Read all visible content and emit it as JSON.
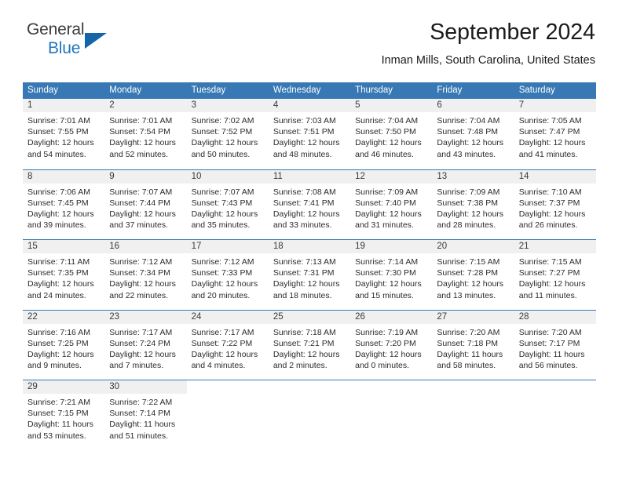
{
  "brand": {
    "name_top": "General",
    "name_bottom": "Blue",
    "triangle_icon": "blue-triangle-icon",
    "color_top": "#3c3c3c",
    "color_bottom": "#2176bd"
  },
  "header": {
    "title": "September 2024",
    "subtitle": "Inman Mills, South Carolina, United States"
  },
  "colors": {
    "header_row_background": "#3878b4",
    "header_row_text": "#ffffff",
    "day_number_band": "#f0f0f0",
    "week_separator": "#3878b4",
    "body_text": "#2b2b2b"
  },
  "weekday_headers": [
    "Sunday",
    "Monday",
    "Tuesday",
    "Wednesday",
    "Thursday",
    "Friday",
    "Saturday"
  ],
  "labels": {
    "sunrise_prefix": "Sunrise:",
    "sunset_prefix": "Sunset:",
    "daylight_prefix": "Daylight:"
  },
  "weeks": [
    {
      "days": [
        {
          "num": "1",
          "l1": "Sunrise: 7:01 AM",
          "l2": "Sunset: 7:55 PM",
          "l3": "Daylight: 12 hours",
          "l4": "and 54 minutes."
        },
        {
          "num": "2",
          "l1": "Sunrise: 7:01 AM",
          "l2": "Sunset: 7:54 PM",
          "l3": "Daylight: 12 hours",
          "l4": "and 52 minutes."
        },
        {
          "num": "3",
          "l1": "Sunrise: 7:02 AM",
          "l2": "Sunset: 7:52 PM",
          "l3": "Daylight: 12 hours",
          "l4": "and 50 minutes."
        },
        {
          "num": "4",
          "l1": "Sunrise: 7:03 AM",
          "l2": "Sunset: 7:51 PM",
          "l3": "Daylight: 12 hours",
          "l4": "and 48 minutes."
        },
        {
          "num": "5",
          "l1": "Sunrise: 7:04 AM",
          "l2": "Sunset: 7:50 PM",
          "l3": "Daylight: 12 hours",
          "l4": "and 46 minutes."
        },
        {
          "num": "6",
          "l1": "Sunrise: 7:04 AM",
          "l2": "Sunset: 7:48 PM",
          "l3": "Daylight: 12 hours",
          "l4": "and 43 minutes."
        },
        {
          "num": "7",
          "l1": "Sunrise: 7:05 AM",
          "l2": "Sunset: 7:47 PM",
          "l3": "Daylight: 12 hours",
          "l4": "and 41 minutes."
        }
      ]
    },
    {
      "days": [
        {
          "num": "8",
          "l1": "Sunrise: 7:06 AM",
          "l2": "Sunset: 7:45 PM",
          "l3": "Daylight: 12 hours",
          "l4": "and 39 minutes."
        },
        {
          "num": "9",
          "l1": "Sunrise: 7:07 AM",
          "l2": "Sunset: 7:44 PM",
          "l3": "Daylight: 12 hours",
          "l4": "and 37 minutes."
        },
        {
          "num": "10",
          "l1": "Sunrise: 7:07 AM",
          "l2": "Sunset: 7:43 PM",
          "l3": "Daylight: 12 hours",
          "l4": "and 35 minutes."
        },
        {
          "num": "11",
          "l1": "Sunrise: 7:08 AM",
          "l2": "Sunset: 7:41 PM",
          "l3": "Daylight: 12 hours",
          "l4": "and 33 minutes."
        },
        {
          "num": "12",
          "l1": "Sunrise: 7:09 AM",
          "l2": "Sunset: 7:40 PM",
          "l3": "Daylight: 12 hours",
          "l4": "and 31 minutes."
        },
        {
          "num": "13",
          "l1": "Sunrise: 7:09 AM",
          "l2": "Sunset: 7:38 PM",
          "l3": "Daylight: 12 hours",
          "l4": "and 28 minutes."
        },
        {
          "num": "14",
          "l1": "Sunrise: 7:10 AM",
          "l2": "Sunset: 7:37 PM",
          "l3": "Daylight: 12 hours",
          "l4": "and 26 minutes."
        }
      ]
    },
    {
      "days": [
        {
          "num": "15",
          "l1": "Sunrise: 7:11 AM",
          "l2": "Sunset: 7:35 PM",
          "l3": "Daylight: 12 hours",
          "l4": "and 24 minutes."
        },
        {
          "num": "16",
          "l1": "Sunrise: 7:12 AM",
          "l2": "Sunset: 7:34 PM",
          "l3": "Daylight: 12 hours",
          "l4": "and 22 minutes."
        },
        {
          "num": "17",
          "l1": "Sunrise: 7:12 AM",
          "l2": "Sunset: 7:33 PM",
          "l3": "Daylight: 12 hours",
          "l4": "and 20 minutes."
        },
        {
          "num": "18",
          "l1": "Sunrise: 7:13 AM",
          "l2": "Sunset: 7:31 PM",
          "l3": "Daylight: 12 hours",
          "l4": "and 18 minutes."
        },
        {
          "num": "19",
          "l1": "Sunrise: 7:14 AM",
          "l2": "Sunset: 7:30 PM",
          "l3": "Daylight: 12 hours",
          "l4": "and 15 minutes."
        },
        {
          "num": "20",
          "l1": "Sunrise: 7:15 AM",
          "l2": "Sunset: 7:28 PM",
          "l3": "Daylight: 12 hours",
          "l4": "and 13 minutes."
        },
        {
          "num": "21",
          "l1": "Sunrise: 7:15 AM",
          "l2": "Sunset: 7:27 PM",
          "l3": "Daylight: 12 hours",
          "l4": "and 11 minutes."
        }
      ]
    },
    {
      "days": [
        {
          "num": "22",
          "l1": "Sunrise: 7:16 AM",
          "l2": "Sunset: 7:25 PM",
          "l3": "Daylight: 12 hours",
          "l4": "and 9 minutes."
        },
        {
          "num": "23",
          "l1": "Sunrise: 7:17 AM",
          "l2": "Sunset: 7:24 PM",
          "l3": "Daylight: 12 hours",
          "l4": "and 7 minutes."
        },
        {
          "num": "24",
          "l1": "Sunrise: 7:17 AM",
          "l2": "Sunset: 7:22 PM",
          "l3": "Daylight: 12 hours",
          "l4": "and 4 minutes."
        },
        {
          "num": "25",
          "l1": "Sunrise: 7:18 AM",
          "l2": "Sunset: 7:21 PM",
          "l3": "Daylight: 12 hours",
          "l4": "and 2 minutes."
        },
        {
          "num": "26",
          "l1": "Sunrise: 7:19 AM",
          "l2": "Sunset: 7:20 PM",
          "l3": "Daylight: 12 hours",
          "l4": "and 0 minutes."
        },
        {
          "num": "27",
          "l1": "Sunrise: 7:20 AM",
          "l2": "Sunset: 7:18 PM",
          "l3": "Daylight: 11 hours",
          "l4": "and 58 minutes."
        },
        {
          "num": "28",
          "l1": "Sunrise: 7:20 AM",
          "l2": "Sunset: 7:17 PM",
          "l3": "Daylight: 11 hours",
          "l4": "and 56 minutes."
        }
      ]
    },
    {
      "days": [
        {
          "num": "29",
          "l1": "Sunrise: 7:21 AM",
          "l2": "Sunset: 7:15 PM",
          "l3": "Daylight: 11 hours",
          "l4": "and 53 minutes."
        },
        {
          "num": "30",
          "l1": "Sunrise: 7:22 AM",
          "l2": "Sunset: 7:14 PM",
          "l3": "Daylight: 11 hours",
          "l4": "and 51 minutes."
        },
        {
          "num": "",
          "l1": "",
          "l2": "",
          "l3": "",
          "l4": ""
        },
        {
          "num": "",
          "l1": "",
          "l2": "",
          "l3": "",
          "l4": ""
        },
        {
          "num": "",
          "l1": "",
          "l2": "",
          "l3": "",
          "l4": ""
        },
        {
          "num": "",
          "l1": "",
          "l2": "",
          "l3": "",
          "l4": ""
        },
        {
          "num": "",
          "l1": "",
          "l2": "",
          "l3": "",
          "l4": ""
        }
      ]
    }
  ]
}
